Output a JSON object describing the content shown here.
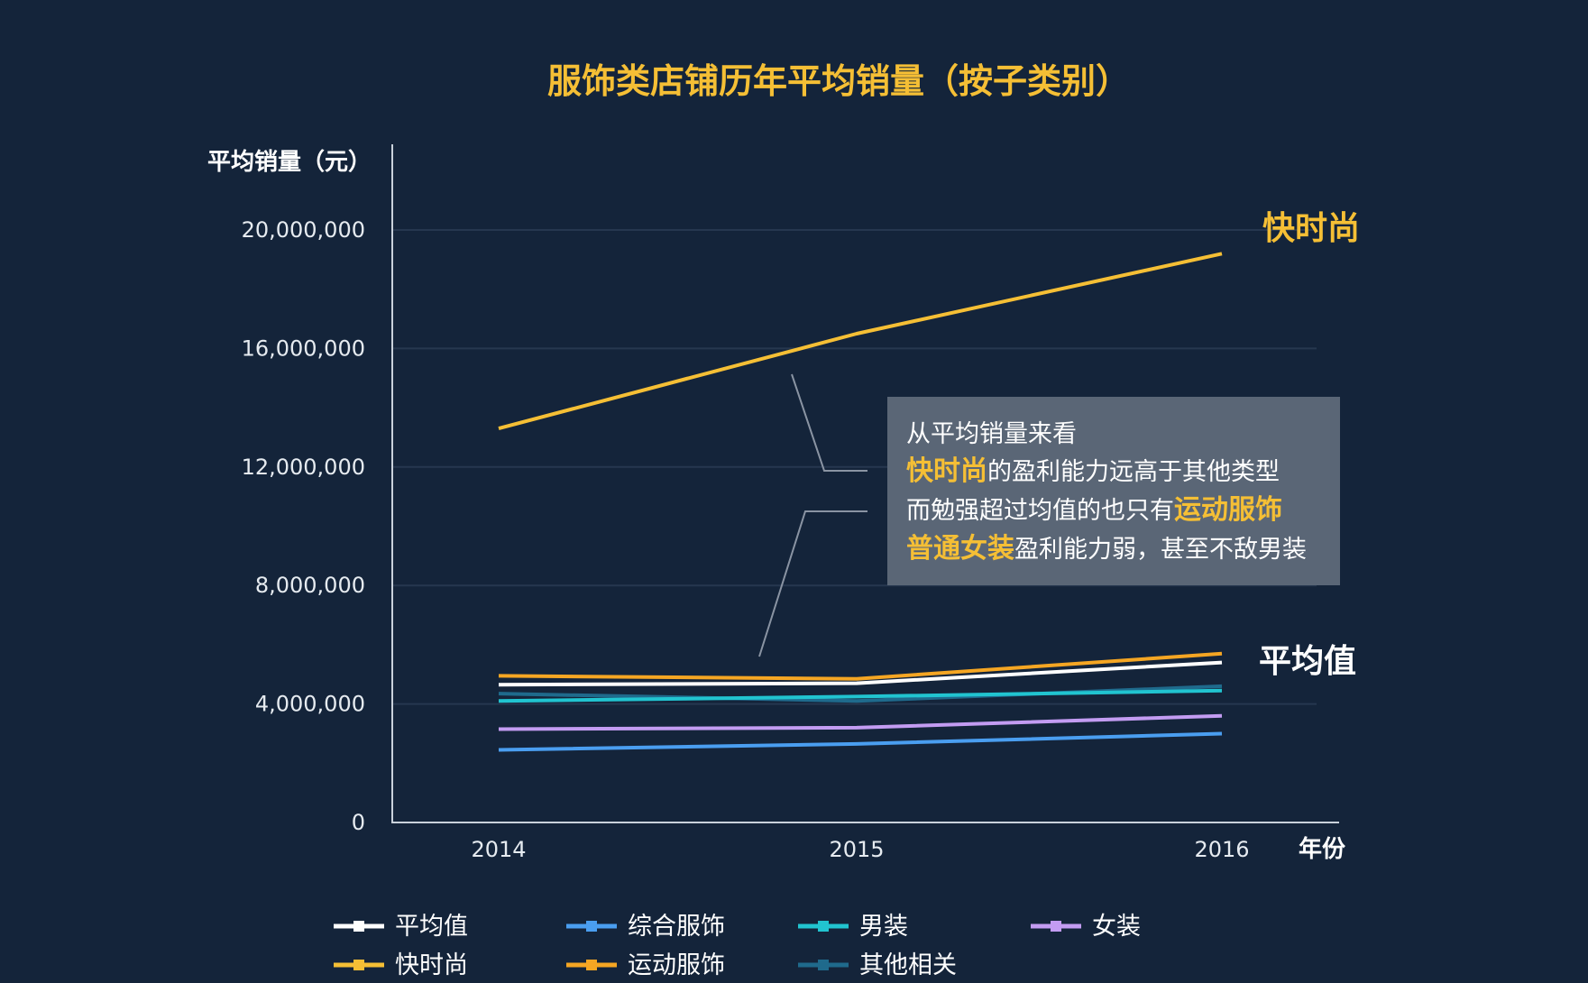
{
  "colors": {
    "background": "#14243a",
    "title": "#f5bf35",
    "axis": "#c9d1db",
    "grid": "#26374f",
    "annotation_box": "#5a6676",
    "highlight": "#f5bf35"
  },
  "chart_data": {
    "type": "line",
    "title": "服饰类店铺历年平均销量（按子类别）",
    "ylabel": "平均销量（元）",
    "xlabel": "年份",
    "x": [
      "2014",
      "2015",
      "2016"
    ],
    "ylim": [
      0,
      22000000
    ],
    "yticks": [
      0,
      4000000,
      8000000,
      12000000,
      16000000,
      20000000
    ],
    "ytick_labels": [
      "0",
      "4,000,000",
      "8,000,000",
      "12,000,000",
      "16,000,000",
      "20,000,000"
    ],
    "grid": true,
    "series": [
      {
        "name": "快时尚",
        "color": "#f5bf35",
        "values": [
          13300000,
          16500000,
          19200000
        ]
      },
      {
        "name": "运动服饰",
        "color": "#f5a623",
        "values": [
          4950000,
          4850000,
          5700000
        ]
      },
      {
        "name": "平均值",
        "color": "#ffffff",
        "values": [
          4650000,
          4700000,
          5400000
        ]
      },
      {
        "name": "男装",
        "color": "#21c4d0",
        "values": [
          4100000,
          4250000,
          4450000
        ]
      },
      {
        "name": "其他相关",
        "color": "#1f6a8c",
        "values": [
          4350000,
          4100000,
          4600000
        ]
      },
      {
        "name": "女装",
        "color": "#c39cf2",
        "values": [
          3150000,
          3200000,
          3600000
        ]
      },
      {
        "name": "综合服饰",
        "color": "#4a9ef0",
        "values": [
          2450000,
          2650000,
          3000000
        ]
      }
    ],
    "end_labels": [
      {
        "text": "快时尚",
        "color": "#f5bf35"
      },
      {
        "text": "平均值",
        "color": "#ffffff"
      }
    ],
    "legend": {
      "placement": "bottom",
      "items": [
        "平均值",
        "综合服饰",
        "男装",
        "女装",
        "快时尚",
        "运动服饰",
        "其他相关"
      ]
    },
    "annotation": {
      "lines": [
        [
          {
            "text": "从平均销量来看",
            "hl": false
          }
        ],
        [
          {
            "text": "快时尚",
            "hl": true
          },
          {
            "text": "的盈利能力远高于其他类型",
            "hl": false
          }
        ],
        [
          {
            "text": "而勉强超过均值的也只有",
            "hl": false
          },
          {
            "text": "运动服饰",
            "hl": true
          }
        ],
        [
          {
            "text": "普通女装",
            "hl": true
          },
          {
            "text": "盈利能力弱，甚至不敌男装",
            "hl": false
          }
        ]
      ]
    }
  }
}
